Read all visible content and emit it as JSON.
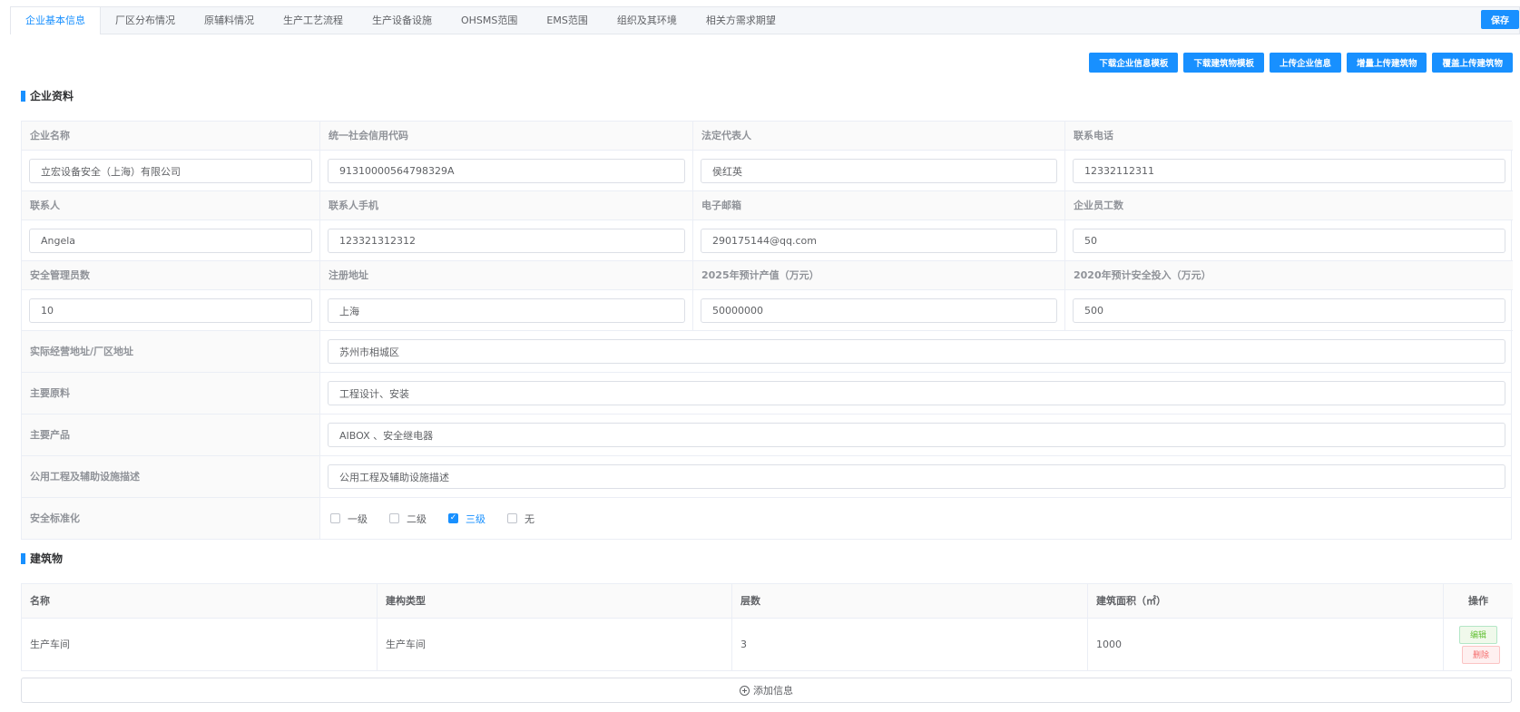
{
  "tabs": [
    {
      "label": "企业基本信息",
      "active": true
    },
    {
      "label": "厂区分布情况"
    },
    {
      "label": "原辅料情况"
    },
    {
      "label": "生产工艺流程"
    },
    {
      "label": "生产设备设施"
    },
    {
      "label": "OHSMS范围"
    },
    {
      "label": "EMS范围"
    },
    {
      "label": "组织及其环境"
    },
    {
      "label": "相关方需求期望"
    }
  ],
  "save_label": "保存",
  "actions": {
    "download_company_template": "下载企业信息模板",
    "download_building_template": "下载建筑物模板",
    "upload_company_info": "上传企业信息",
    "incremental_upload_buildings": "增量上传建筑物",
    "overwrite_upload_buildings": "覆盖上传建筑物"
  },
  "company_section_title": "企业资料",
  "fields": {
    "company_name": {
      "label": "企业名称",
      "value": "立宏设备安全（上海）有限公司"
    },
    "credit_code": {
      "label": "统一社会信用代码",
      "value": "91310000564798329A"
    },
    "legal_rep": {
      "label": "法定代表人",
      "value": "侯红英"
    },
    "phone": {
      "label": "联系电话",
      "value": "12332112311"
    },
    "contact": {
      "label": "联系人",
      "value": "Angela"
    },
    "contact_mobile": {
      "label": "联系人手机",
      "value": "123321312312"
    },
    "email": {
      "label": "电子邮箱",
      "value": "290175144@qq.com"
    },
    "employees": {
      "label": "企业员工数",
      "value": "50"
    },
    "safety_staff": {
      "label": "安全管理员数",
      "value": "10"
    },
    "reg_address": {
      "label": "注册地址",
      "value": "上海"
    },
    "output_2025": {
      "label": "2025年预计产值（万元）",
      "value": "50000000"
    },
    "safety_invest_2020": {
      "label": "2020年预计安全投入（万元）",
      "value": "500"
    },
    "actual_address": {
      "label": "实际经营地址/厂区地址",
      "value": "苏州市相城区"
    },
    "main_materials": {
      "label": "主要原料",
      "value": "工程设计、安装"
    },
    "main_products": {
      "label": "主要产品",
      "value": "AIBOX 、安全继电器"
    },
    "utilities": {
      "label": "公用工程及辅助设施描述",
      "value": "公用工程及辅助设施描述"
    },
    "safety_standard": {
      "label": "安全标准化"
    }
  },
  "safety_levels": [
    {
      "label": "一级",
      "checked": false
    },
    {
      "label": "二级",
      "checked": false
    },
    {
      "label": "三级",
      "checked": true
    },
    {
      "label": "无",
      "checked": false
    }
  ],
  "buildings_section_title": "建筑物",
  "buildings": {
    "columns": [
      "名称",
      "建构类型",
      "层数",
      "建筑面积（㎡）",
      "操作"
    ],
    "rows": [
      {
        "name": "生产车间",
        "type": "生产车间",
        "floors": "3",
        "area": "1000"
      }
    ],
    "edit_label": "编辑",
    "delete_label": "删除",
    "add_label": "添加信息"
  }
}
